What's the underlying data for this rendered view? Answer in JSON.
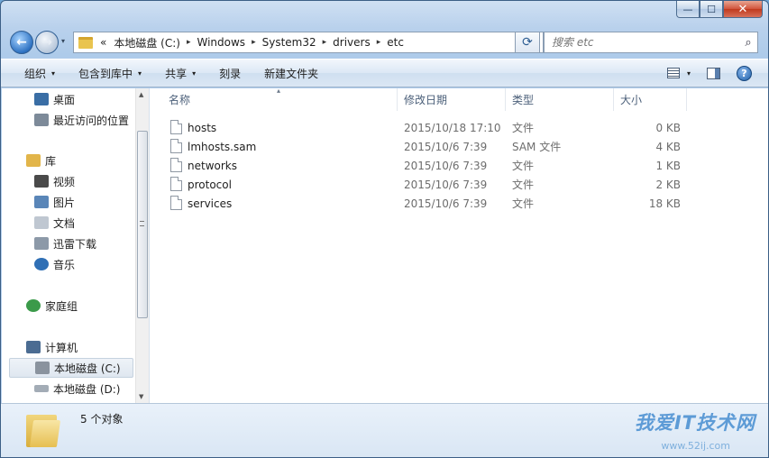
{
  "window": {
    "min_label": "—",
    "max_label": "☐",
    "close_label": "✕"
  },
  "nav": {
    "back_label": "←",
    "forward_label": "→",
    "history_label": "▾",
    "breadcrumb_prefix": "«",
    "breadcrumbs": [
      "本地磁盘 (C:)",
      "Windows",
      "System32",
      "drivers",
      "etc"
    ],
    "crumb_sep": "▸",
    "dropdown_label": "▾",
    "refresh_label": "⟳",
    "search_placeholder": "搜索 etc",
    "search_icon_label": "⌕"
  },
  "toolbar": {
    "items": [
      {
        "label": "组织",
        "dropdown": "▾"
      },
      {
        "label": "包含到库中",
        "dropdown": "▾"
      },
      {
        "label": "共享",
        "dropdown": "▾"
      },
      {
        "label": "刻录",
        "dropdown": ""
      },
      {
        "label": "新建文件夹",
        "dropdown": ""
      }
    ],
    "view_dropdown": "▾",
    "help_label": "?"
  },
  "navpane": {
    "items": [
      {
        "label": "桌面",
        "icon": "desktop-icon",
        "color": "#3a6ea5"
      },
      {
        "label": "最近访问的位置",
        "icon": "recent-places-icon",
        "color": "#7d8a99"
      },
      {
        "label": "库",
        "icon": "libraries-icon",
        "color": "#e2b54a"
      },
      {
        "label": "视频",
        "icon": "videos-icon",
        "color": "#4a4a4a"
      },
      {
        "label": "图片",
        "icon": "pictures-icon",
        "color": "#5a86b8"
      },
      {
        "label": "文档",
        "icon": "documents-icon",
        "color": "#bfc7d1"
      },
      {
        "label": "迅雷下载",
        "icon": "downloads-icon",
        "color": "#8c99a8"
      },
      {
        "label": "音乐",
        "icon": "music-icon",
        "color": "#2f6fb5"
      },
      {
        "label": "家庭组",
        "icon": "homegroup-icon",
        "color": "#3b9a4a"
      },
      {
        "label": "计算机",
        "icon": "computer-icon",
        "color": "#4b6c92"
      },
      {
        "label": "本地磁盘 (C:)",
        "icon": "drive-c-icon",
        "color": "#8a939e"
      },
      {
        "label": "本地磁盘 (D:)",
        "icon": "drive-d-icon",
        "color": "#a3acb6"
      }
    ],
    "scroll_up": "▲",
    "scroll_down": "▼"
  },
  "files": {
    "sort_indicator": "▴",
    "columns": [
      "名称",
      "修改日期",
      "类型",
      "大小"
    ],
    "rows": [
      {
        "name": "hosts",
        "date": "2015/10/18 17:10",
        "type": "文件",
        "size": "0 KB"
      },
      {
        "name": "lmhosts.sam",
        "date": "2015/10/6 7:39",
        "type": "SAM 文件",
        "size": "4 KB"
      },
      {
        "name": "networks",
        "date": "2015/10/6 7:39",
        "type": "文件",
        "size": "1 KB"
      },
      {
        "name": "protocol",
        "date": "2015/10/6 7:39",
        "type": "文件",
        "size": "2 KB"
      },
      {
        "name": "services",
        "date": "2015/10/6 7:39",
        "type": "文件",
        "size": "18 KB"
      }
    ]
  },
  "details": {
    "count_label": "5 个对象"
  },
  "watermark": {
    "line1": "我爱IT技术网",
    "line2": "www.52ij.com"
  },
  "colors": {
    "accent": "#3c5f86",
    "selected_bg": "#dfe7f0"
  }
}
